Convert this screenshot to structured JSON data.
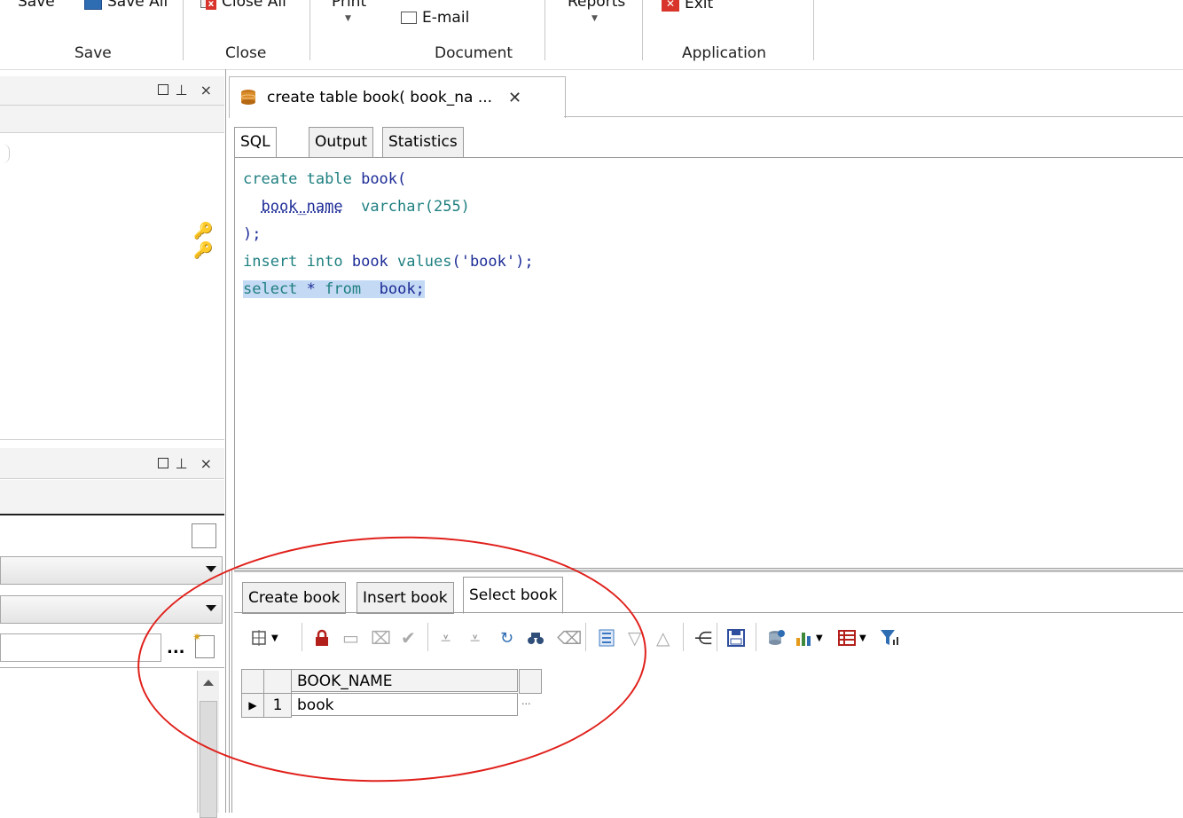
{
  "ribbon": {
    "buttons": {
      "save": "Save",
      "save_all": "Save All",
      "close_all": "Close All",
      "print": "Print",
      "email": "E-mail",
      "reports": "Reports",
      "exit": "Exit"
    },
    "groups": {
      "save": "Save",
      "close": "Close",
      "document": "Document",
      "application": "Application"
    }
  },
  "document_tab": {
    "title": "create table book( book_na ...",
    "close_glyph": "✕"
  },
  "editor_tabs": [
    "SQL",
    "Output",
    "Statistics"
  ],
  "sql": {
    "line1": {
      "kw": "create table",
      "id": "book("
    },
    "line2": {
      "col": "book_name",
      "type": "varchar(255)"
    },
    "line3": ");",
    "line4": {
      "kw1": "insert into",
      "id": "book",
      "kw2": "values",
      "val": "('book');"
    },
    "line5": {
      "kw1": "select",
      "star": "*",
      "kw2": "from",
      "id": "book;"
    }
  },
  "result_tabs": [
    "Create book",
    "Insert book",
    "Select book"
  ],
  "grid": {
    "columns": [
      "BOOK_NAME"
    ],
    "rows": [
      {
        "num": "1",
        "values": [
          "book"
        ]
      }
    ],
    "ellipsis": "..."
  },
  "left_panel": {
    "browse_button": "..."
  },
  "colors": {
    "keyword": "#1f7f80",
    "identifier": "#1d2c96",
    "selection": "#c3d9f4",
    "annotation": "#e0201b"
  }
}
